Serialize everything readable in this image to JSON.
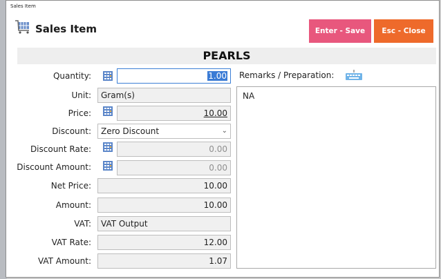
{
  "window": {
    "title": "Sales Item"
  },
  "header": {
    "title": "Sales Item",
    "icon": "cart-icon"
  },
  "buttons": {
    "save_label": "Enter - Save",
    "close_label": "Esc - Close",
    "save_color": "#e8577d",
    "close_color": "#ee6a2b"
  },
  "product": {
    "name": "PEARLS"
  },
  "form": {
    "quantity": {
      "label": "Quantity:",
      "value": "1.00"
    },
    "unit": {
      "label": "Unit:",
      "value": "Gram(s)"
    },
    "price": {
      "label": "Price:",
      "value": "10.00"
    },
    "discount": {
      "label": "Discount:",
      "value": "Zero Discount"
    },
    "discount_rate": {
      "label": "Discount Rate:",
      "value": "0.00"
    },
    "discount_amount": {
      "label": "Discount Amount:",
      "value": "0.00"
    },
    "net_price": {
      "label": "Net Price:",
      "value": "10.00"
    },
    "amount": {
      "label": "Amount:",
      "value": "10.00"
    },
    "vat": {
      "label": "VAT:",
      "value": "VAT Output"
    },
    "vat_rate": {
      "label": "VAT Rate:",
      "value": "12.00"
    },
    "vat_amount": {
      "label": "VAT Amount:",
      "value": "1.07"
    }
  },
  "remarks": {
    "label": "Remarks / Preparation:",
    "value": "NA",
    "icon": "keyboard-icon"
  }
}
